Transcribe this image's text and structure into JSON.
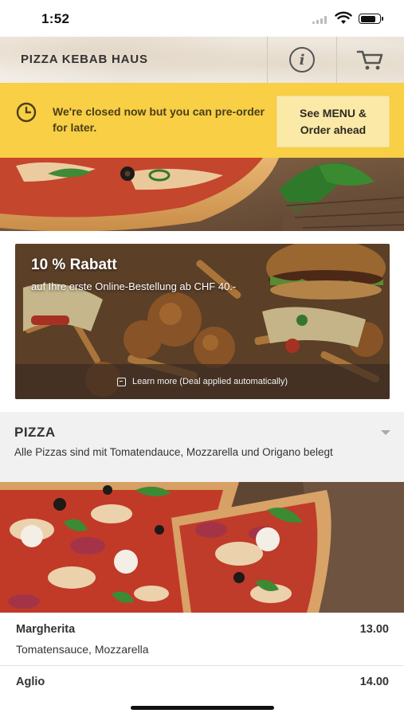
{
  "status_bar": {
    "time": "1:52",
    "battery_level": 0.8
  },
  "header": {
    "title": "PIZZA KEBAB HAUS",
    "info_icon": "info-icon",
    "cart_icon": "cart-icon",
    "info_glyph": "i"
  },
  "closed_banner": {
    "icon": "clock-icon",
    "message": "We're closed now but you can pre-order for later.",
    "button_label_line1": "See MENU &",
    "button_label_line2": "Order ahead",
    "color": "#f8cf45"
  },
  "deal": {
    "title": "10 % Rabatt",
    "subtitle": "auf Ihre erste Online-Bestellung ab CHF 40.-",
    "footer": "Learn more (Deal applied automatically)"
  },
  "category": {
    "title": "PIZZA",
    "description": "Alle Pizzas sind mit Tomatendauce, Mozzarella und Origano belegt"
  },
  "items": [
    {
      "name": "Margherita",
      "price": "13.00",
      "description": "Tomatensauce, Mozzarella"
    },
    {
      "name": "Aglio",
      "price": "14.00",
      "description": ""
    }
  ]
}
